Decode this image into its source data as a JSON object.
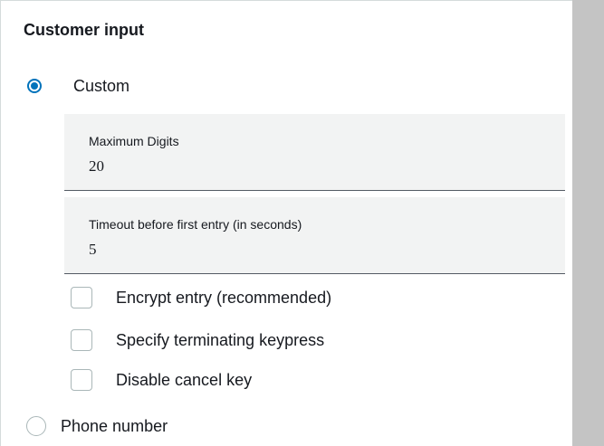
{
  "section": {
    "title": "Customer input"
  },
  "options": {
    "custom": {
      "label": "Custom",
      "checked": true
    },
    "phone_number": {
      "label": "Phone number",
      "checked": false
    }
  },
  "fields": {
    "max_digits": {
      "label": "Maximum Digits",
      "value": "20"
    },
    "timeout": {
      "label": "Timeout before first entry (in seconds)",
      "value": "5"
    }
  },
  "checkboxes": {
    "encrypt": {
      "label": "Encrypt entry (recommended)",
      "checked": false
    },
    "terminating": {
      "label": "Specify terminating keypress",
      "checked": false
    },
    "cancel": {
      "label": "Disable cancel key",
      "checked": false
    }
  },
  "colors": {
    "accent": "#0073bb",
    "field_bg": "#f2f3f3",
    "scrollbar": "#c4c4c4"
  }
}
